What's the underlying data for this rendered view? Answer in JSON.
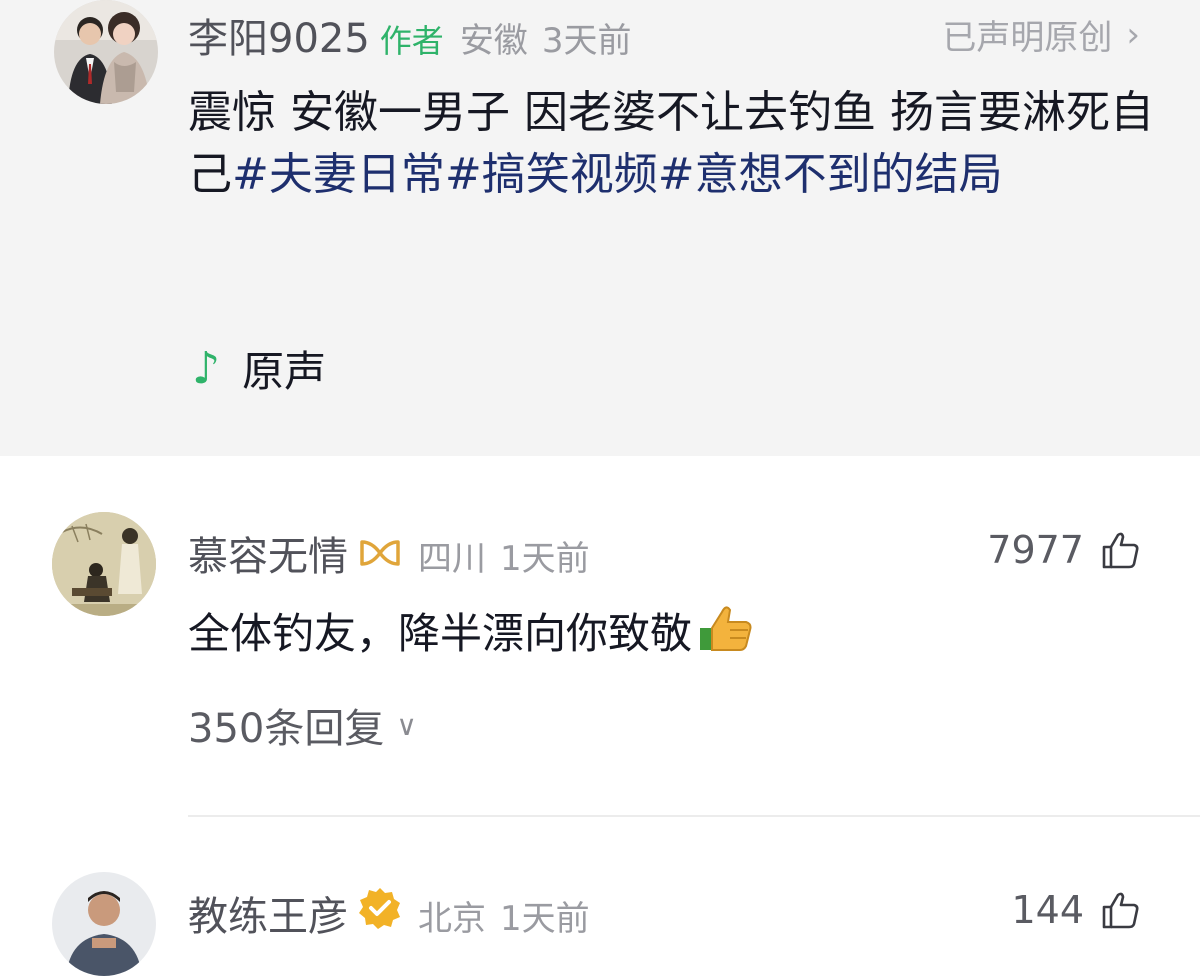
{
  "author_post": {
    "username": "李阳9025",
    "author_tag": "作者",
    "location": "安徽",
    "time": "3天前",
    "claim": "已声明原创",
    "caption_text": "震惊 安徽一男子 因老婆不让去钓鱼 扬言要淋死自己",
    "hashtags": [
      "#夫妻日常",
      "#搞笑视频",
      "#意想不到的结局"
    ],
    "music_label": "原声",
    "colors": {
      "accent_green": "#2fb36a",
      "hashtag": "#1e2f6e",
      "panel_bg": "#f4f4f4"
    }
  },
  "comments": [
    {
      "username": "慕容无情",
      "badge_icon": "gold-infinity-badge-icon",
      "location": "四川",
      "time": "1天前",
      "likes": "7977",
      "text": "全体钓友，降半漂向你致敬",
      "emoji_icon": "thumbs-up-emoji",
      "replies_label": "350条回复"
    },
    {
      "username": "教练王彦",
      "badge_icon": "verified-gold-badge-icon",
      "location": "北京",
      "time": "1天前",
      "likes": "144"
    }
  ]
}
